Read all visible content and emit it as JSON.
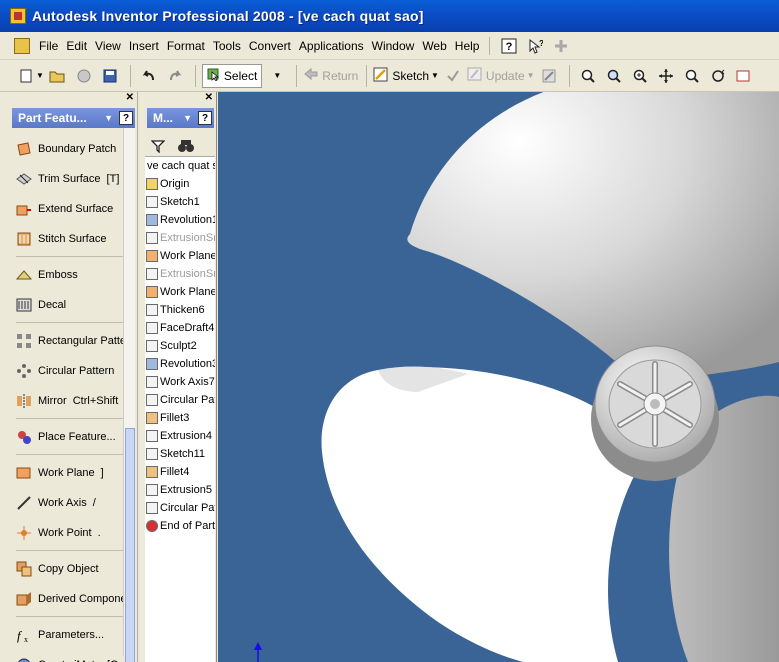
{
  "window": {
    "title": "Autodesk Inventor Professional 2008 - [ve cach quat sao]"
  },
  "menu": {
    "items": [
      "File",
      "Edit",
      "View",
      "Insert",
      "Format",
      "Tools",
      "Convert",
      "Applications",
      "Window",
      "Web",
      "Help"
    ],
    "icons": [
      "help-icon",
      "whats-this-icon",
      "add-icon"
    ]
  },
  "toolbar": {
    "select_label": "Select",
    "return_label": "Return",
    "sketch_label": "Sketch",
    "update_label": "Update"
  },
  "part_features": {
    "header": "Part Featu...",
    "help": "?",
    "groups": [
      [
        {
          "label": "Boundary Patch",
          "shortcut": "",
          "icon": "boundary-patch-icon"
        },
        {
          "label": "Trim Surface",
          "shortcut": "[T]",
          "icon": "trim-surface-icon"
        },
        {
          "label": "Extend Surface",
          "shortcut": "",
          "icon": "extend-surface-icon"
        },
        {
          "label": "Stitch Surface",
          "shortcut": "",
          "icon": "stitch-surface-icon"
        }
      ],
      [
        {
          "label": "Emboss",
          "shortcut": "",
          "icon": "emboss-icon"
        },
        {
          "label": "Decal",
          "shortcut": "",
          "icon": "decal-icon"
        }
      ],
      [
        {
          "label": "Rectangular Patte",
          "shortcut": "",
          "icon": "rectangular-pattern-icon"
        },
        {
          "label": "Circular Pattern",
          "shortcut": "",
          "icon": "circular-pattern-icon"
        },
        {
          "label": "Mirror",
          "shortcut": "Ctrl+Shift",
          "icon": "mirror-icon"
        }
      ],
      [
        {
          "label": "Place Feature...",
          "shortcut": "",
          "icon": "place-feature-icon"
        }
      ],
      [
        {
          "label": "Work Plane",
          "shortcut": "]",
          "icon": "work-plane-icon"
        },
        {
          "label": "Work Axis",
          "shortcut": "/",
          "icon": "work-axis-icon"
        },
        {
          "label": "Work Point",
          "shortcut": ".",
          "icon": "work-point-icon"
        }
      ],
      [
        {
          "label": "Copy Object",
          "shortcut": "",
          "icon": "copy-object-icon"
        },
        {
          "label": "Derived Componer",
          "shortcut": "",
          "icon": "derived-component-icon"
        }
      ],
      [
        {
          "label": "Parameters...",
          "shortcut": "",
          "icon": "parameters-icon"
        },
        {
          "label": "Create iMate",
          "shortcut": "[Q",
          "icon": "create-imate-icon"
        }
      ]
    ]
  },
  "browser": {
    "header": "M...",
    "help": "?",
    "items": [
      {
        "label": "ve cach quat sa",
        "state": "root"
      },
      {
        "label": "Origin",
        "state": "normal"
      },
      {
        "label": "Sketch1",
        "state": "normal"
      },
      {
        "label": "Revolution1",
        "state": "normal"
      },
      {
        "label": "ExtrusionSr",
        "state": "suppressed"
      },
      {
        "label": "Work Plane",
        "state": "normal"
      },
      {
        "label": "ExtrusionSr",
        "state": "suppressed"
      },
      {
        "label": "Work Plane",
        "state": "normal"
      },
      {
        "label": "Thicken6",
        "state": "normal"
      },
      {
        "label": "FaceDraft4",
        "state": "normal"
      },
      {
        "label": "Sculpt2",
        "state": "normal"
      },
      {
        "label": "Revolution3",
        "state": "normal"
      },
      {
        "label": "Work Axis7",
        "state": "normal"
      },
      {
        "label": "Circular Pat",
        "state": "normal"
      },
      {
        "label": "Fillet3",
        "state": "normal"
      },
      {
        "label": "Extrusion4",
        "state": "normal"
      },
      {
        "label": "Sketch11",
        "state": "normal"
      },
      {
        "label": "Fillet4",
        "state": "normal"
      },
      {
        "label": "Extrusion5",
        "state": "normal"
      },
      {
        "label": "Circular Pat",
        "state": "normal"
      },
      {
        "label": "End of Part",
        "state": "normal"
      }
    ]
  },
  "colors": {
    "viewport_bg": "#3a6496",
    "title_bar": "#0b4ec6",
    "panel_header": "#6a86d4"
  }
}
